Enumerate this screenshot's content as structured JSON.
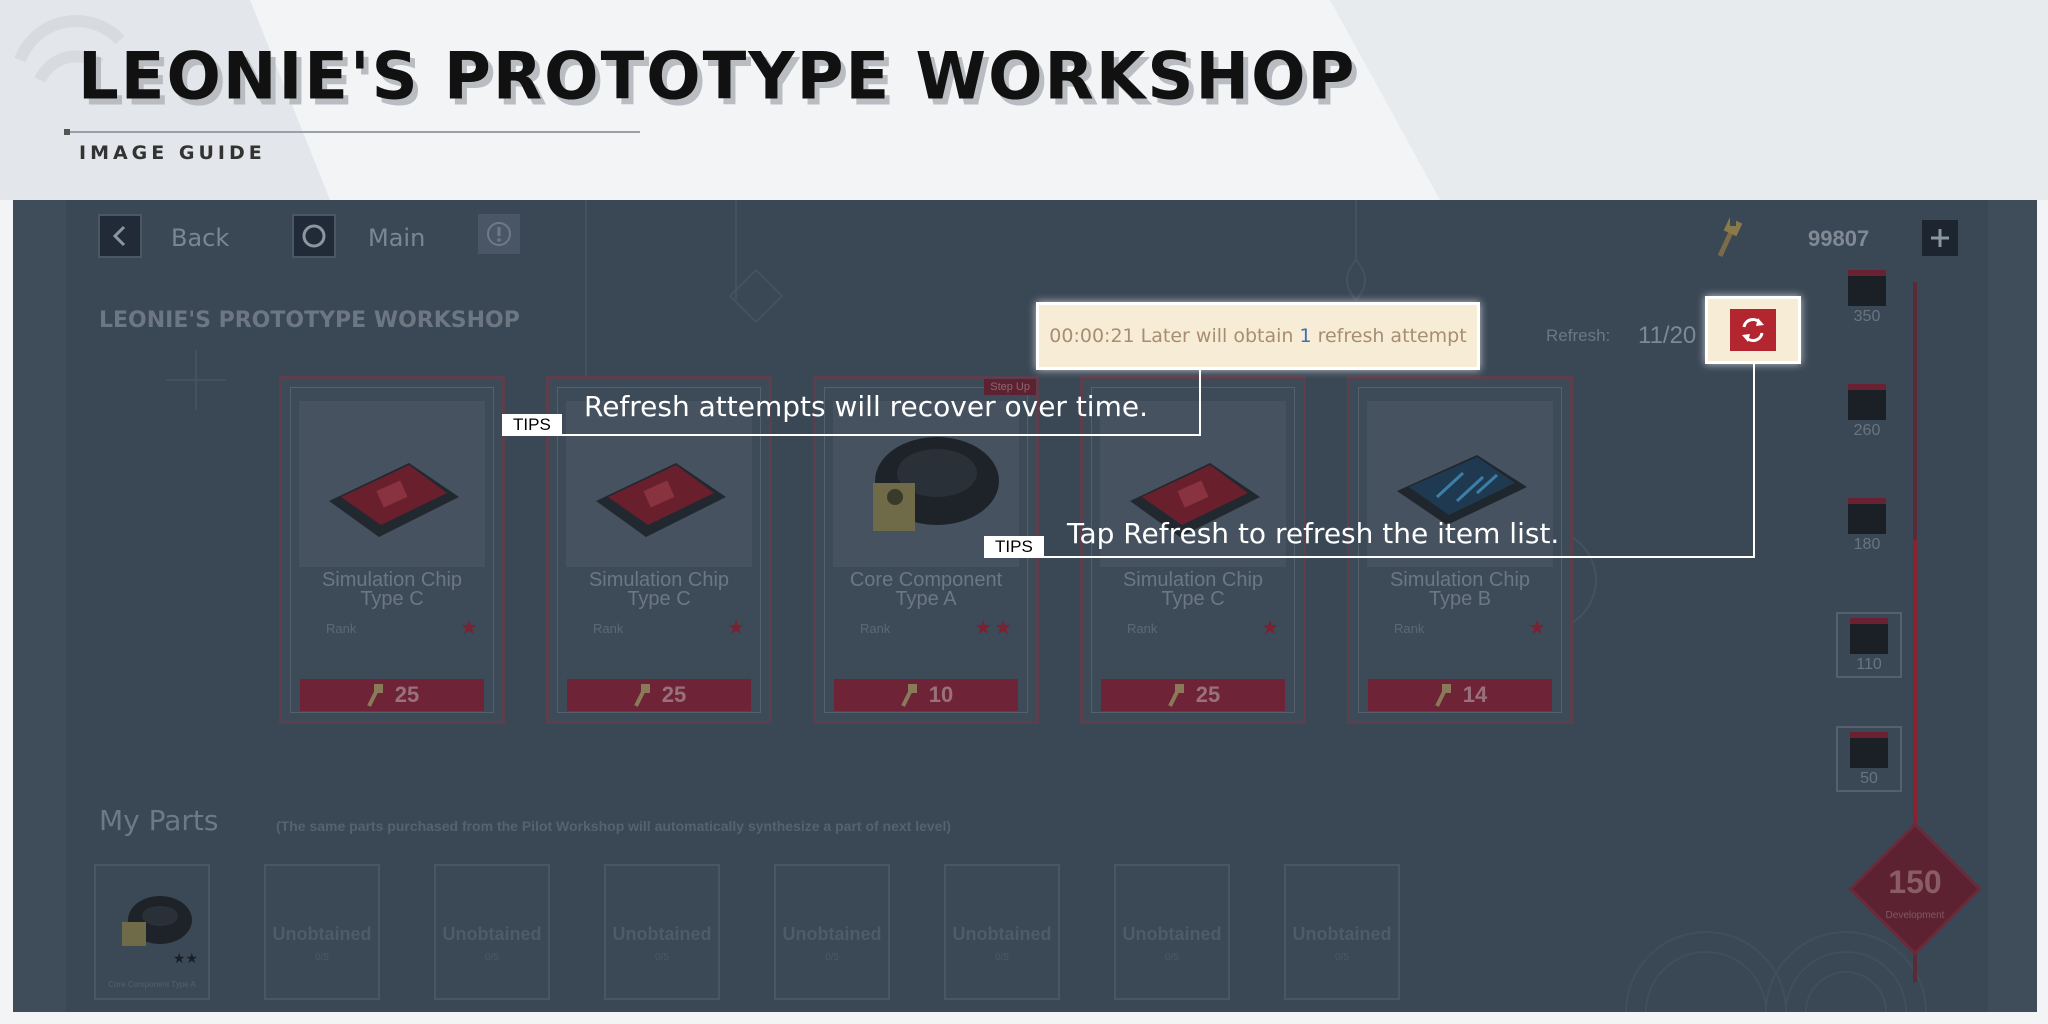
{
  "guide": {
    "title": "LEONIE'S PROTOTYPE WORKSHOP",
    "subtitle": "IMAGE GUIDE"
  },
  "nav": {
    "back_label": "Back",
    "main_label": "Main"
  },
  "currency": {
    "amount": "99807"
  },
  "workshop_title": "LEONIE'S PROTOTYPE WORKSHOP",
  "refresh": {
    "label": "Refresh:",
    "count": "11/20",
    "timer_time": "00:00:21",
    "timer_text_a": " Later will obtain ",
    "timer_num": "1",
    "timer_text_b": " refresh attempt"
  },
  "tips": {
    "tag": "TIPS",
    "tip1": "Refresh attempts will recover over time.",
    "tip2": "Tap Refresh to refresh the item list."
  },
  "cards": [
    {
      "name_line1": "Simulation Chip",
      "name_line2": "Type C",
      "rank_label": "Rank",
      "stars": "★",
      "price": "25",
      "art": "chip-red"
    },
    {
      "name_line1": "Simulation Chip",
      "name_line2": "Type C",
      "rank_label": "Rank",
      "stars": "★",
      "price": "25",
      "art": "chip-red"
    },
    {
      "name_line1": "Core Component",
      "name_line2": "Type A",
      "rank_label": "Rank",
      "stars": "★★",
      "price": "10",
      "art": "core",
      "tag": "Step Up"
    },
    {
      "name_line1": "Simulation Chip",
      "name_line2": "Type C",
      "rank_label": "Rank",
      "stars": "★",
      "price": "25",
      "art": "chip-red"
    },
    {
      "name_line1": "Simulation Chip",
      "name_line2": "Type B",
      "rank_label": "Rank",
      "stars": "★",
      "price": "14",
      "art": "chip-blue"
    }
  ],
  "side_rewards": [
    "350",
    "260",
    "180",
    "110",
    "50"
  ],
  "development": {
    "value": "150",
    "label": "Development"
  },
  "my_parts": {
    "title": "My Parts",
    "note": "(The same parts purchased from the Pilot Workshop will automatically synthesize a part of next level)",
    "first_item": {
      "name": "Core Component Type A",
      "stars": "★★"
    },
    "unobtained_label": "Unobtained",
    "unobtained_sub": "0/5",
    "slots": 7
  },
  "colors": {
    "accent_red": "#b3262f",
    "tip_white": "#ffffff",
    "overlay_bg": "#3a4755"
  }
}
